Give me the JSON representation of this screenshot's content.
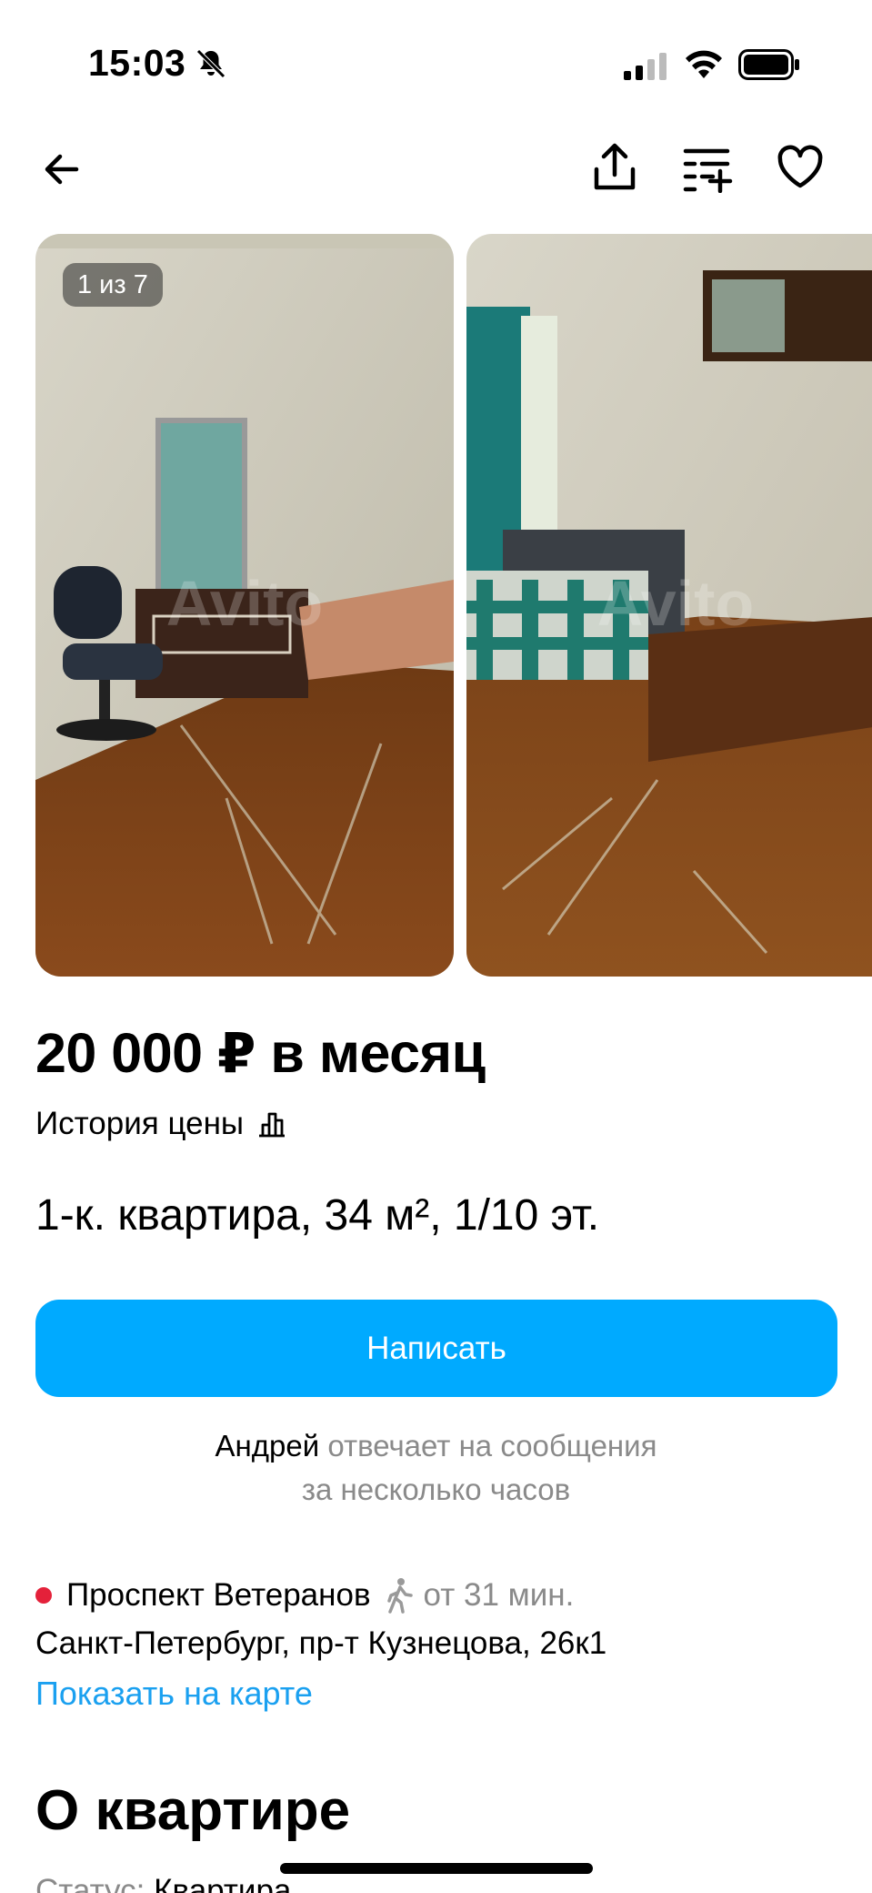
{
  "status_bar": {
    "time": "15:03"
  },
  "gallery": {
    "counter": "1 из 7",
    "watermark": "Avito"
  },
  "listing": {
    "price": "20 000 ₽ в месяц",
    "price_history_label": "История цены",
    "title": "1-к. квартира, 34 м², 1/10 эт."
  },
  "actions": {
    "write_label": "Написать"
  },
  "seller": {
    "name": "Андрей",
    "reply_line1": "отвечает на сообщения",
    "reply_line2": "за несколько часов"
  },
  "location": {
    "metro_station": "Проспект Ветеранов",
    "metro_color": "#e4213a",
    "walk_time": "от 31 мин.",
    "address": "Санкт-Петербург, пр-т Кузнецова, 26к1",
    "map_link": "Показать на карте"
  },
  "about": {
    "heading": "О квартире",
    "status_label": "Статус:",
    "status_value": "Квартира"
  },
  "colors": {
    "accent": "#00aaff",
    "link": "#1aa0f0"
  }
}
